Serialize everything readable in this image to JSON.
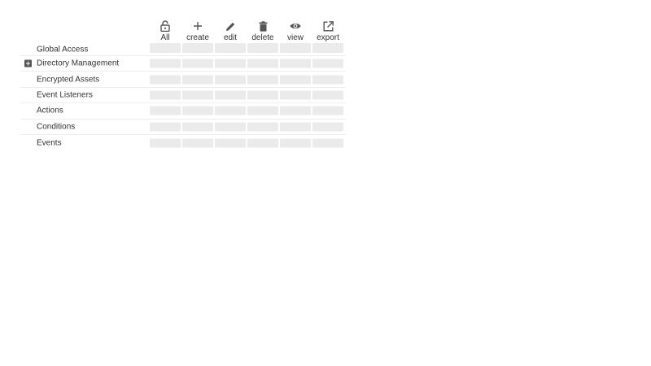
{
  "columns": [
    {
      "label": "All",
      "icon": "lock-open-icon"
    },
    {
      "label": "create",
      "icon": "plus-icon"
    },
    {
      "label": "edit",
      "icon": "pencil-icon"
    },
    {
      "label": "delete",
      "icon": "trash-icon"
    },
    {
      "label": "view",
      "icon": "eye-icon"
    },
    {
      "label": "export",
      "icon": "external-link-icon"
    }
  ],
  "rows": [
    {
      "label": "Global Access",
      "expandable": false
    },
    {
      "label": "Directory Management",
      "expandable": true
    },
    {
      "label": "Encrypted Assets",
      "expandable": false
    },
    {
      "label": "Event Listeners",
      "expandable": false
    },
    {
      "label": "Actions",
      "expandable": false
    },
    {
      "label": "Conditions",
      "expandable": false
    },
    {
      "label": "Events",
      "expandable": false
    }
  ],
  "colors": {
    "cell_placeholder": "#ebebeb",
    "icon": "#555555",
    "divider": "#eeeeee"
  }
}
